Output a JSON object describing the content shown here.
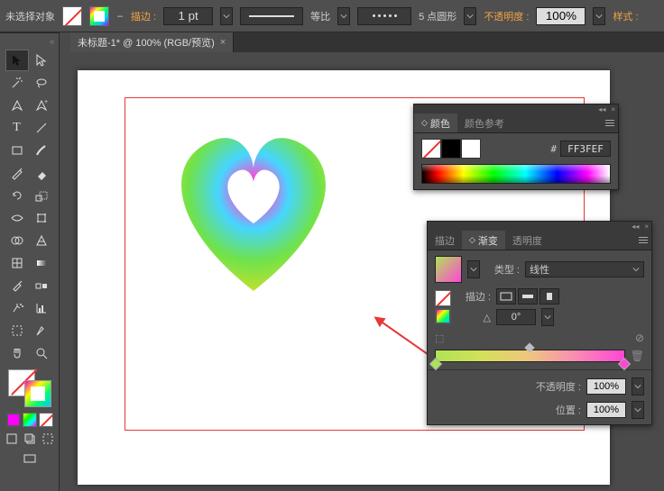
{
  "option_bar": {
    "selection_label": "未选择对象",
    "stroke_label": "描边 :",
    "stroke_weight": "1 pt",
    "profile_label": "等比",
    "dash_label": "5 点圆形",
    "opacity_label": "不透明度 :",
    "opacity_value": "100%",
    "style_label": "样式 :"
  },
  "document": {
    "tab_title": "未标题-1* @ 100% (RGB/预览)"
  },
  "color_panel": {
    "tab_color": "颜色",
    "tab_guide": "颜色参考",
    "hash": "#",
    "hex": "FF3FEF"
  },
  "gradient_panel": {
    "tab_stroke": "描边",
    "tab_gradient": "渐变",
    "tab_opacity": "透明度",
    "type_label": "类型 :",
    "type_value": "线性",
    "stroke_label": "描边 :",
    "angle_symbol": "△",
    "angle_value": "0°",
    "opacity_label": "不透明度 :",
    "opacity_value": "100%",
    "location_label": "位置 :",
    "location_value": "100%"
  },
  "chart_data": {
    "type": "gradient",
    "gradient_type": "线性",
    "angle": 0,
    "opacity": 100,
    "location": 100,
    "stops": [
      {
        "position": 0,
        "color": "#b0e256"
      },
      {
        "position": 100,
        "color": "#ff46d6"
      }
    ]
  }
}
